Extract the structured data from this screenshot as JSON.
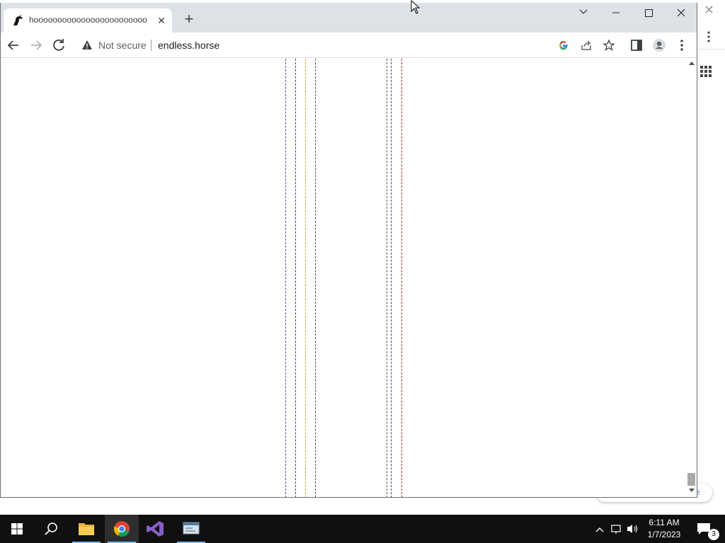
{
  "browser": {
    "tab": {
      "title": "hoooooooooooooooooooooooo",
      "favicon": "horse-icon"
    },
    "new_tab": "+",
    "toolbar": {
      "security_label": "Not secure",
      "url": "endless.horse"
    },
    "window_controls": [
      "tab-search",
      "minimize",
      "maximize",
      "close"
    ]
  },
  "page": {
    "leg_colors": [
      "#5a4e9a",
      "#3a3a9a",
      "#c9a42a",
      "#4a4a4a",
      "#5a5a5a",
      "#3f3f6a",
      "#a0302a"
    ]
  },
  "background_window": {
    "pill_text": "e"
  },
  "taskbar": {
    "time": "6:11 AM",
    "date": "1/7/2023",
    "notification_count": "3",
    "apps": [
      "start",
      "search",
      "file-explorer",
      "chrome",
      "visual-studio",
      "app"
    ]
  },
  "colors": {
    "tabstrip": "#dee1e6",
    "taskbar": "#101010",
    "running_indicator": "#76b9ed"
  }
}
